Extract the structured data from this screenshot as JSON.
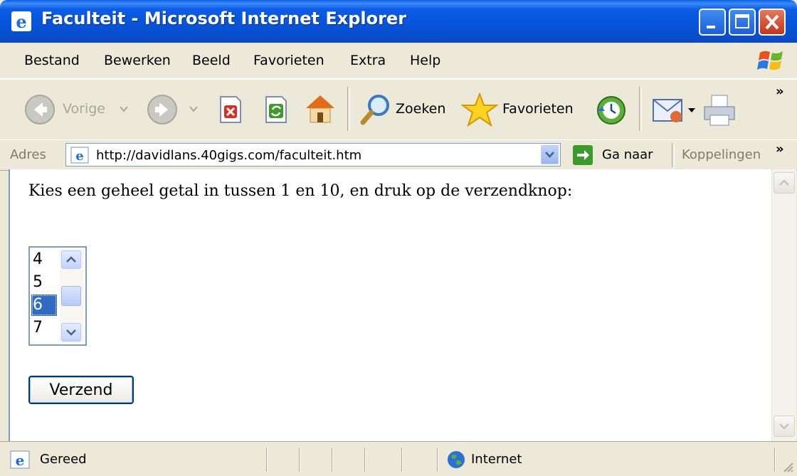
{
  "window": {
    "title": "Faculteit - Microsoft Internet Explorer"
  },
  "menu": {
    "items": [
      "Bestand",
      "Bewerken",
      "Beeld",
      "Favorieten",
      "Extra",
      "Help"
    ]
  },
  "toolbar": {
    "back_label": "Vorige",
    "search_label": "Zoeken",
    "favorites_label": "Favorieten"
  },
  "address": {
    "label": "Adres",
    "url": "http://davidlans.40gigs.com/faculteit.htm",
    "go_label": "Ga naar",
    "links_label": "Koppelingen"
  },
  "page": {
    "prompt": "Kies een geheel getal in tussen 1 en 10, en druk op de verzendknop:",
    "list_options": [
      "4",
      "5",
      "6",
      "7"
    ],
    "selected_option": "6",
    "submit_label": "Verzend"
  },
  "status": {
    "text": "Gereed",
    "zone": "Internet"
  },
  "colors": {
    "titlebar": "#0653D9",
    "selection": "#316AC5",
    "chrome": "#ECE9D8"
  }
}
